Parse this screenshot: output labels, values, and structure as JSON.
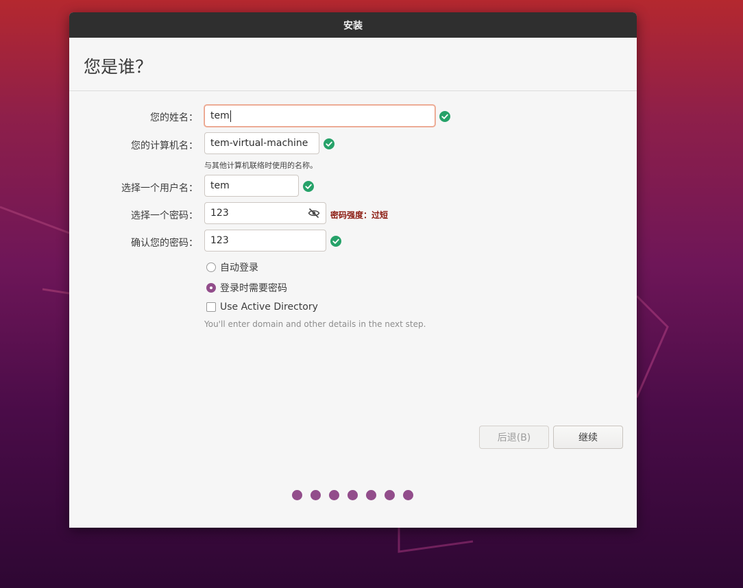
{
  "window": {
    "title": "安装"
  },
  "page": {
    "title": "您是谁？"
  },
  "form": {
    "name": {
      "label": "您的姓名：",
      "value": "tem",
      "valid": true
    },
    "computer_name": {
      "label": "您的计算机名：",
      "value": "tem-virtual-machine",
      "hint": "与其他计算机联络时使用的名称。",
      "valid": true
    },
    "username": {
      "label": "选择一个用户名：",
      "value": "tem",
      "valid": true
    },
    "password": {
      "label": "选择一个密码：",
      "value": "123",
      "strength": "密码强度：过短",
      "icon": "eye-hidden-icon"
    },
    "confirm_password": {
      "label": "确认您的密码：",
      "value": "123",
      "valid": true
    },
    "login_options": [
      {
        "label": "自动登录",
        "selected": false
      },
      {
        "label": "登录时需要密码",
        "selected": true
      }
    ],
    "active_directory": {
      "label": "Use Active Directory",
      "checked": false,
      "hint": "You'll enter domain and other details in the next step."
    }
  },
  "buttons": {
    "back": {
      "label": "后退(B)",
      "enabled": false
    },
    "continue": {
      "label": "继续",
      "enabled": true
    }
  },
  "progress": {
    "total_steps": 7
  },
  "colors": {
    "accent": "#924d8b",
    "valid": "#26a269",
    "warning": "#8b1a10",
    "titlebar": "#2f2f2f"
  }
}
